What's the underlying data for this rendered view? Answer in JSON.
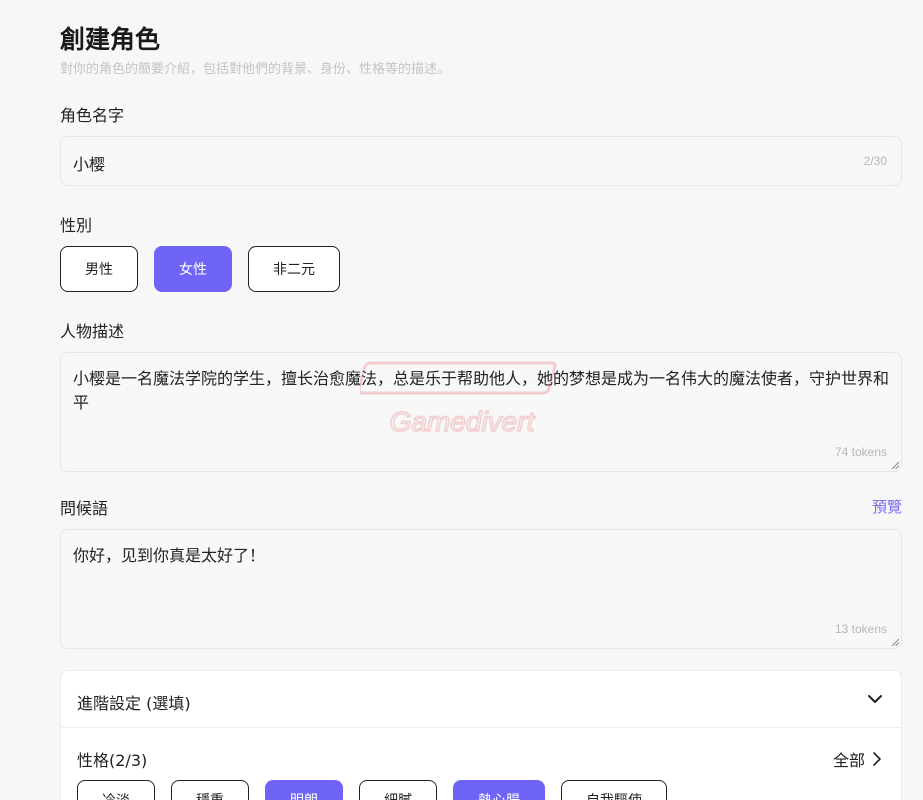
{
  "header": {
    "title": "創建角色",
    "subtitle": "對你的角色的簡要介紹，包括對他們的背景、身份、性格等的描述。"
  },
  "name_field": {
    "label": "角色名字",
    "value": "小樱",
    "counter": "2/30"
  },
  "gender": {
    "label": "性別",
    "options": [
      {
        "label": "男性",
        "selected": false
      },
      {
        "label": "女性",
        "selected": true
      },
      {
        "label": "非二元",
        "selected": false
      }
    ]
  },
  "description": {
    "label": "人物描述",
    "value": "小樱是一名魔法学院的学生，擅长治愈魔法，总是乐于帮助他人，她的梦想是成为一名伟大的魔法使者，守护世界和平",
    "tokens": "74 tokens"
  },
  "greeting": {
    "label": "問候語",
    "preview_link": "預覽",
    "value": "你好，见到你真是太好了！",
    "tokens": "13 tokens"
  },
  "advanced": {
    "title": "進階設定 (選填)",
    "trait_label": "性格(2/3)",
    "all_link": "全部",
    "traits": [
      {
        "label": "冷淡",
        "selected": false
      },
      {
        "label": "穩重",
        "selected": false
      },
      {
        "label": "明朗",
        "selected": true
      },
      {
        "label": "細膩",
        "selected": false
      },
      {
        "label": "熱心腸",
        "selected": true
      },
      {
        "label": "自我驅使",
        "selected": false
      }
    ]
  },
  "watermark": {
    "text": "Gamedivert"
  },
  "colors": {
    "accent": "#7064f6",
    "link": "#7a6ff0",
    "background": "#f7f7f7"
  },
  "icons": [
    "chevron-down-icon",
    "chevron-right-icon",
    "resize-handle-icon"
  ]
}
